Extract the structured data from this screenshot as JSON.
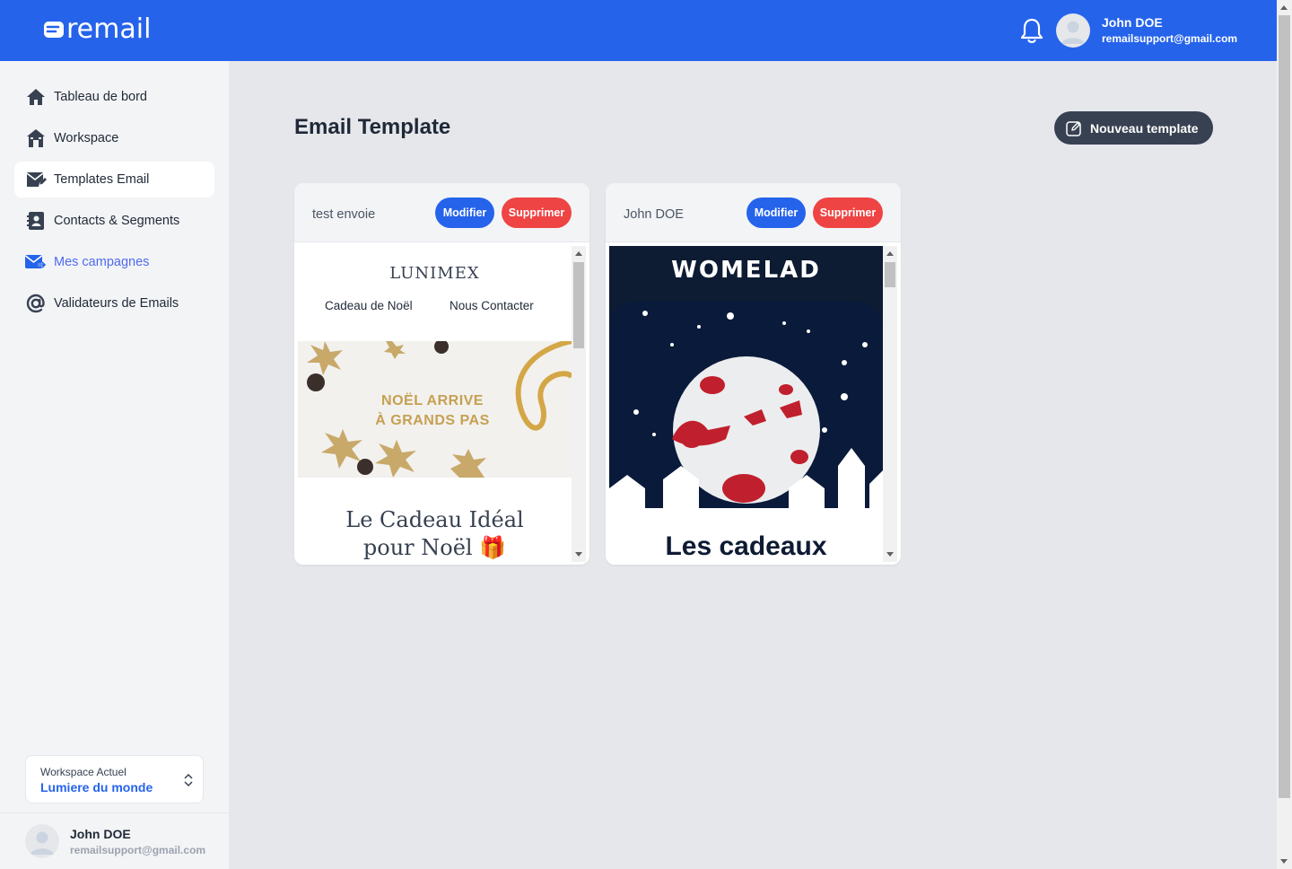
{
  "app": {
    "logo_text": "remail",
    "colors": {
      "primary": "#2563eb",
      "danger": "#ef4444",
      "dark_button": "#374151",
      "active_nav_text": "#4f6bed"
    }
  },
  "header": {
    "notification_icon": "bell-icon",
    "user": {
      "name": "John DOE",
      "email": "remailsupport@gmail.com",
      "avatar_icon": "user-avatar-icon"
    }
  },
  "sidebar": {
    "items": [
      {
        "label": "Tableau de bord",
        "icon": "home-icon"
      },
      {
        "label": "Workspace",
        "icon": "building-icon"
      },
      {
        "label": "Templates Email",
        "icon": "mail-edit-icon"
      },
      {
        "label": "Contacts & Segments",
        "icon": "contact-book-icon"
      },
      {
        "label": "Mes campagnes",
        "icon": "mail-send-icon"
      },
      {
        "label": "Validateurs de Emails",
        "icon": "at-sign-icon"
      }
    ],
    "workspace": {
      "label": "Workspace Actuel",
      "value": "Lumiere du monde"
    },
    "user": {
      "name": "John DOE",
      "email": "remailsupport@gmail.com"
    }
  },
  "main": {
    "title": "Email Template",
    "new_button_label": "Nouveau template",
    "templates": [
      {
        "name": "test envoie",
        "edit_label": "Modifier",
        "delete_label": "Supprimer",
        "preview": {
          "brand": "LUNIMEX",
          "nav": [
            "Cadeau de Noël",
            "Nous Contacter"
          ],
          "banner_line1": "NOËL ARRIVE",
          "banner_line2": "À GRANDS PAS",
          "headline_line1": "Le Cadeau Idéal",
          "headline_line2": "pour Noël 🎁"
        }
      },
      {
        "name": "John DOE",
        "edit_label": "Modifier",
        "delete_label": "Supprimer",
        "preview": {
          "brand": "WOMELAD",
          "headline": "Les cadeaux"
        }
      }
    ]
  }
}
